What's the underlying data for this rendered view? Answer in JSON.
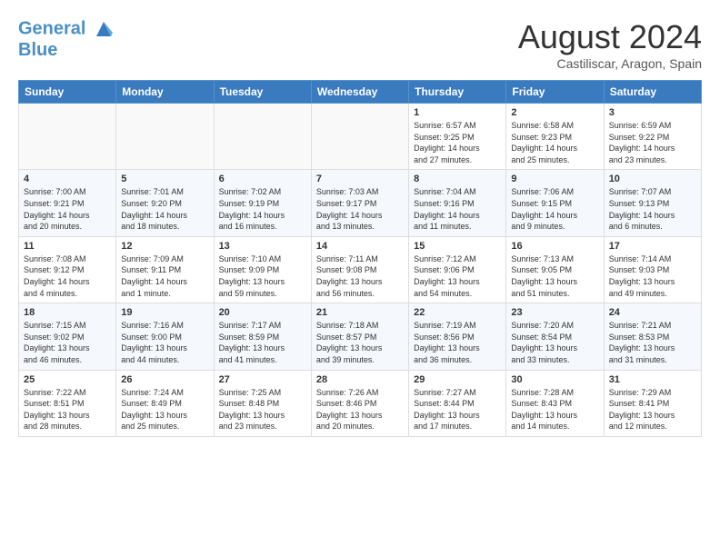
{
  "header": {
    "logo_line1": "General",
    "logo_line2": "Blue",
    "month_title": "August 2024",
    "location": "Castiliscar, Aragon, Spain"
  },
  "days_of_week": [
    "Sunday",
    "Monday",
    "Tuesday",
    "Wednesday",
    "Thursday",
    "Friday",
    "Saturday"
  ],
  "weeks": [
    {
      "days": [
        {
          "number": "",
          "info": ""
        },
        {
          "number": "",
          "info": ""
        },
        {
          "number": "",
          "info": ""
        },
        {
          "number": "",
          "info": ""
        },
        {
          "number": "1",
          "info": "Sunrise: 6:57 AM\nSunset: 9:25 PM\nDaylight: 14 hours\nand 27 minutes."
        },
        {
          "number": "2",
          "info": "Sunrise: 6:58 AM\nSunset: 9:23 PM\nDaylight: 14 hours\nand 25 minutes."
        },
        {
          "number": "3",
          "info": "Sunrise: 6:59 AM\nSunset: 9:22 PM\nDaylight: 14 hours\nand 23 minutes."
        }
      ]
    },
    {
      "days": [
        {
          "number": "4",
          "info": "Sunrise: 7:00 AM\nSunset: 9:21 PM\nDaylight: 14 hours\nand 20 minutes."
        },
        {
          "number": "5",
          "info": "Sunrise: 7:01 AM\nSunset: 9:20 PM\nDaylight: 14 hours\nand 18 minutes."
        },
        {
          "number": "6",
          "info": "Sunrise: 7:02 AM\nSunset: 9:19 PM\nDaylight: 14 hours\nand 16 minutes."
        },
        {
          "number": "7",
          "info": "Sunrise: 7:03 AM\nSunset: 9:17 PM\nDaylight: 14 hours\nand 13 minutes."
        },
        {
          "number": "8",
          "info": "Sunrise: 7:04 AM\nSunset: 9:16 PM\nDaylight: 14 hours\nand 11 minutes."
        },
        {
          "number": "9",
          "info": "Sunrise: 7:06 AM\nSunset: 9:15 PM\nDaylight: 14 hours\nand 9 minutes."
        },
        {
          "number": "10",
          "info": "Sunrise: 7:07 AM\nSunset: 9:13 PM\nDaylight: 14 hours\nand 6 minutes."
        }
      ]
    },
    {
      "days": [
        {
          "number": "11",
          "info": "Sunrise: 7:08 AM\nSunset: 9:12 PM\nDaylight: 14 hours\nand 4 minutes."
        },
        {
          "number": "12",
          "info": "Sunrise: 7:09 AM\nSunset: 9:11 PM\nDaylight: 14 hours\nand 1 minute."
        },
        {
          "number": "13",
          "info": "Sunrise: 7:10 AM\nSunset: 9:09 PM\nDaylight: 13 hours\nand 59 minutes."
        },
        {
          "number": "14",
          "info": "Sunrise: 7:11 AM\nSunset: 9:08 PM\nDaylight: 13 hours\nand 56 minutes."
        },
        {
          "number": "15",
          "info": "Sunrise: 7:12 AM\nSunset: 9:06 PM\nDaylight: 13 hours\nand 54 minutes."
        },
        {
          "number": "16",
          "info": "Sunrise: 7:13 AM\nSunset: 9:05 PM\nDaylight: 13 hours\nand 51 minutes."
        },
        {
          "number": "17",
          "info": "Sunrise: 7:14 AM\nSunset: 9:03 PM\nDaylight: 13 hours\nand 49 minutes."
        }
      ]
    },
    {
      "days": [
        {
          "number": "18",
          "info": "Sunrise: 7:15 AM\nSunset: 9:02 PM\nDaylight: 13 hours\nand 46 minutes."
        },
        {
          "number": "19",
          "info": "Sunrise: 7:16 AM\nSunset: 9:00 PM\nDaylight: 13 hours\nand 44 minutes."
        },
        {
          "number": "20",
          "info": "Sunrise: 7:17 AM\nSunset: 8:59 PM\nDaylight: 13 hours\nand 41 minutes."
        },
        {
          "number": "21",
          "info": "Sunrise: 7:18 AM\nSunset: 8:57 PM\nDaylight: 13 hours\nand 39 minutes."
        },
        {
          "number": "22",
          "info": "Sunrise: 7:19 AM\nSunset: 8:56 PM\nDaylight: 13 hours\nand 36 minutes."
        },
        {
          "number": "23",
          "info": "Sunrise: 7:20 AM\nSunset: 8:54 PM\nDaylight: 13 hours\nand 33 minutes."
        },
        {
          "number": "24",
          "info": "Sunrise: 7:21 AM\nSunset: 8:53 PM\nDaylight: 13 hours\nand 31 minutes."
        }
      ]
    },
    {
      "days": [
        {
          "number": "25",
          "info": "Sunrise: 7:22 AM\nSunset: 8:51 PM\nDaylight: 13 hours\nand 28 minutes."
        },
        {
          "number": "26",
          "info": "Sunrise: 7:24 AM\nSunset: 8:49 PM\nDaylight: 13 hours\nand 25 minutes."
        },
        {
          "number": "27",
          "info": "Sunrise: 7:25 AM\nSunset: 8:48 PM\nDaylight: 13 hours\nand 23 minutes."
        },
        {
          "number": "28",
          "info": "Sunrise: 7:26 AM\nSunset: 8:46 PM\nDaylight: 13 hours\nand 20 minutes."
        },
        {
          "number": "29",
          "info": "Sunrise: 7:27 AM\nSunset: 8:44 PM\nDaylight: 13 hours\nand 17 minutes."
        },
        {
          "number": "30",
          "info": "Sunrise: 7:28 AM\nSunset: 8:43 PM\nDaylight: 13 hours\nand 14 minutes."
        },
        {
          "number": "31",
          "info": "Sunrise: 7:29 AM\nSunset: 8:41 PM\nDaylight: 13 hours\nand 12 minutes."
        }
      ]
    }
  ]
}
